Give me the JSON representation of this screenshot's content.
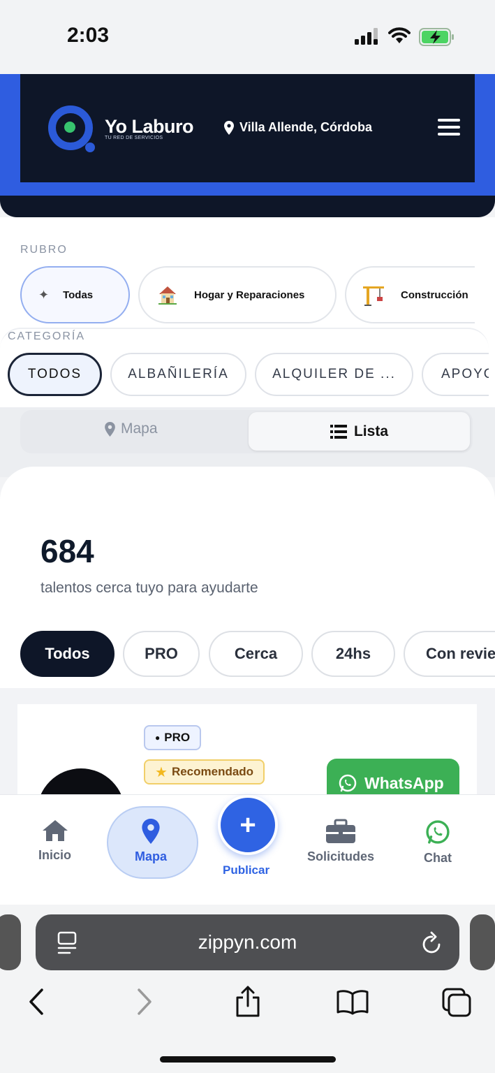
{
  "status_bar": {
    "time": "2:03"
  },
  "header": {
    "brand": "Yo Laburo",
    "brand_sub": "TU RED DE SERVICIOS",
    "location": "Villa Allende, Córdoba"
  },
  "rubro": {
    "label": "RUBRO",
    "items": [
      {
        "label": "Todas",
        "icon": "sparkle-icon",
        "active": true
      },
      {
        "label": "Hogar y Reparaciones",
        "icon": "house-icon",
        "active": false
      },
      {
        "label": "Construcción",
        "icon": "crane-icon",
        "active": false
      }
    ]
  },
  "categoria": {
    "label": "CATEGORÍA",
    "items": [
      {
        "label": "TODOS",
        "active": true
      },
      {
        "label": "ALBAÑILERÍA",
        "active": false
      },
      {
        "label": "ALQUILER DE ...",
        "active": false
      },
      {
        "label": "APOYO",
        "active": false
      }
    ]
  },
  "view_toggle": {
    "map": "Mapa",
    "list": "Lista",
    "selected": "Lista"
  },
  "results": {
    "count": "684",
    "subtitle": "talentos cerca tuyo para ayudarte",
    "filters": [
      {
        "label": "Todos",
        "active": true
      },
      {
        "label": "PRO",
        "active": false
      },
      {
        "label": "Cerca",
        "active": false
      },
      {
        "label": "24hs",
        "active": false
      },
      {
        "label": "Con reviews",
        "active": false
      }
    ]
  },
  "listing": {
    "pro_badge": "PRO",
    "recommended_badge": "Recomendado",
    "whatsapp_label": "WhatsApp"
  },
  "bottom_nav": {
    "items": [
      {
        "label": "Inicio",
        "icon": "home-icon"
      },
      {
        "label": "Mapa",
        "icon": "map-pin-icon",
        "active": true
      },
      {
        "label": "Publicar",
        "icon": "plus-icon"
      },
      {
        "label": "Solicitudes",
        "icon": "briefcase-icon"
      },
      {
        "label": "Chat",
        "icon": "whatsapp-icon"
      }
    ]
  },
  "browser": {
    "url": "zippyn.com"
  },
  "colors": {
    "brand_dark": "#0e1628",
    "brand_blue": "#2f5de0",
    "whatsapp_green": "#3cb055"
  }
}
